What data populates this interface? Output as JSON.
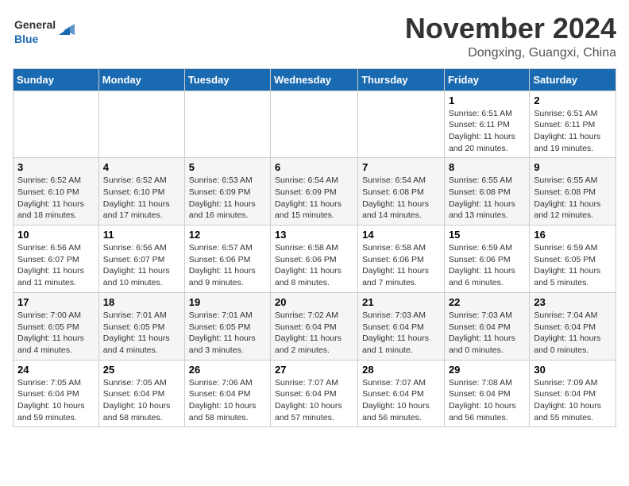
{
  "header": {
    "logo_line1": "General",
    "logo_line2": "Blue",
    "month": "November 2024",
    "location": "Dongxing, Guangxi, China"
  },
  "weekdays": [
    "Sunday",
    "Monday",
    "Tuesday",
    "Wednesday",
    "Thursday",
    "Friday",
    "Saturday"
  ],
  "weeks": [
    [
      {
        "day": "",
        "info": ""
      },
      {
        "day": "",
        "info": ""
      },
      {
        "day": "",
        "info": ""
      },
      {
        "day": "",
        "info": ""
      },
      {
        "day": "",
        "info": ""
      },
      {
        "day": "1",
        "info": "Sunrise: 6:51 AM\nSunset: 6:11 PM\nDaylight: 11 hours and 20 minutes."
      },
      {
        "day": "2",
        "info": "Sunrise: 6:51 AM\nSunset: 6:11 PM\nDaylight: 11 hours and 19 minutes."
      }
    ],
    [
      {
        "day": "3",
        "info": "Sunrise: 6:52 AM\nSunset: 6:10 PM\nDaylight: 11 hours and 18 minutes."
      },
      {
        "day": "4",
        "info": "Sunrise: 6:52 AM\nSunset: 6:10 PM\nDaylight: 11 hours and 17 minutes."
      },
      {
        "day": "5",
        "info": "Sunrise: 6:53 AM\nSunset: 6:09 PM\nDaylight: 11 hours and 16 minutes."
      },
      {
        "day": "6",
        "info": "Sunrise: 6:54 AM\nSunset: 6:09 PM\nDaylight: 11 hours and 15 minutes."
      },
      {
        "day": "7",
        "info": "Sunrise: 6:54 AM\nSunset: 6:08 PM\nDaylight: 11 hours and 14 minutes."
      },
      {
        "day": "8",
        "info": "Sunrise: 6:55 AM\nSunset: 6:08 PM\nDaylight: 11 hours and 13 minutes."
      },
      {
        "day": "9",
        "info": "Sunrise: 6:55 AM\nSunset: 6:08 PM\nDaylight: 11 hours and 12 minutes."
      }
    ],
    [
      {
        "day": "10",
        "info": "Sunrise: 6:56 AM\nSunset: 6:07 PM\nDaylight: 11 hours and 11 minutes."
      },
      {
        "day": "11",
        "info": "Sunrise: 6:56 AM\nSunset: 6:07 PM\nDaylight: 11 hours and 10 minutes."
      },
      {
        "day": "12",
        "info": "Sunrise: 6:57 AM\nSunset: 6:06 PM\nDaylight: 11 hours and 9 minutes."
      },
      {
        "day": "13",
        "info": "Sunrise: 6:58 AM\nSunset: 6:06 PM\nDaylight: 11 hours and 8 minutes."
      },
      {
        "day": "14",
        "info": "Sunrise: 6:58 AM\nSunset: 6:06 PM\nDaylight: 11 hours and 7 minutes."
      },
      {
        "day": "15",
        "info": "Sunrise: 6:59 AM\nSunset: 6:06 PM\nDaylight: 11 hours and 6 minutes."
      },
      {
        "day": "16",
        "info": "Sunrise: 6:59 AM\nSunset: 6:05 PM\nDaylight: 11 hours and 5 minutes."
      }
    ],
    [
      {
        "day": "17",
        "info": "Sunrise: 7:00 AM\nSunset: 6:05 PM\nDaylight: 11 hours and 4 minutes."
      },
      {
        "day": "18",
        "info": "Sunrise: 7:01 AM\nSunset: 6:05 PM\nDaylight: 11 hours and 4 minutes."
      },
      {
        "day": "19",
        "info": "Sunrise: 7:01 AM\nSunset: 6:05 PM\nDaylight: 11 hours and 3 minutes."
      },
      {
        "day": "20",
        "info": "Sunrise: 7:02 AM\nSunset: 6:04 PM\nDaylight: 11 hours and 2 minutes."
      },
      {
        "day": "21",
        "info": "Sunrise: 7:03 AM\nSunset: 6:04 PM\nDaylight: 11 hours and 1 minute."
      },
      {
        "day": "22",
        "info": "Sunrise: 7:03 AM\nSunset: 6:04 PM\nDaylight: 11 hours and 0 minutes."
      },
      {
        "day": "23",
        "info": "Sunrise: 7:04 AM\nSunset: 6:04 PM\nDaylight: 11 hours and 0 minutes."
      }
    ],
    [
      {
        "day": "24",
        "info": "Sunrise: 7:05 AM\nSunset: 6:04 PM\nDaylight: 10 hours and 59 minutes."
      },
      {
        "day": "25",
        "info": "Sunrise: 7:05 AM\nSunset: 6:04 PM\nDaylight: 10 hours and 58 minutes."
      },
      {
        "day": "26",
        "info": "Sunrise: 7:06 AM\nSunset: 6:04 PM\nDaylight: 10 hours and 58 minutes."
      },
      {
        "day": "27",
        "info": "Sunrise: 7:07 AM\nSunset: 6:04 PM\nDaylight: 10 hours and 57 minutes."
      },
      {
        "day": "28",
        "info": "Sunrise: 7:07 AM\nSunset: 6:04 PM\nDaylight: 10 hours and 56 minutes."
      },
      {
        "day": "29",
        "info": "Sunrise: 7:08 AM\nSunset: 6:04 PM\nDaylight: 10 hours and 56 minutes."
      },
      {
        "day": "30",
        "info": "Sunrise: 7:09 AM\nSunset: 6:04 PM\nDaylight: 10 hours and 55 minutes."
      }
    ]
  ]
}
